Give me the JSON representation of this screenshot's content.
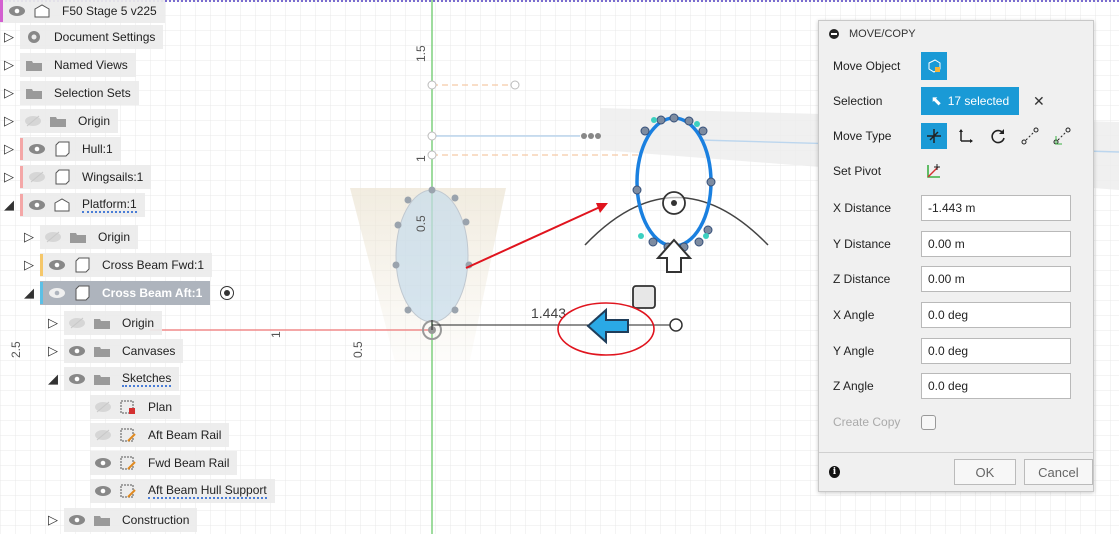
{
  "tree": {
    "root": "F50 Stage 5 v225",
    "document_settings": "Document Settings",
    "named_views": "Named Views",
    "selection_sets": "Selection Sets",
    "origin_top": "Origin",
    "hull": "Hull:1",
    "wingsails": "Wingsails:1",
    "platform": "Platform:1",
    "platform_origin": "Origin",
    "cross_beam_fwd": "Cross Beam Fwd:1",
    "cross_beam_aft": "Cross Beam Aft:1",
    "aft_origin": "Origin",
    "canvases": "Canvases",
    "sketches": "Sketches",
    "plan": "Plan",
    "aft_beam_rail": "Aft Beam Rail",
    "fwd_beam_rail": "Fwd Beam Rail",
    "aft_beam_hull_support": "Aft Beam Hull Support",
    "construction": "Construction"
  },
  "viewport": {
    "ruler_labels": [
      "1.5",
      "1",
      "0.5",
      "2.5",
      "1",
      "0.5"
    ],
    "dimension": "1.443"
  },
  "dialog": {
    "title": "MOVE/COPY",
    "move_object_label": "Move Object",
    "selection_label": "Selection",
    "selection_value": "17 selected",
    "clear_glyph": "✕",
    "move_type_label": "Move Type",
    "set_pivot_label": "Set Pivot",
    "x_distance_label": "X Distance",
    "x_distance": "-1.443 m",
    "y_distance_label": "Y Distance",
    "y_distance": "0.00 m",
    "z_distance_label": "Z Distance",
    "z_distance": "0.00 m",
    "x_angle_label": "X Angle",
    "x_angle": "0.0 deg",
    "y_angle_label": "Y Angle",
    "y_angle": "0.0 deg",
    "z_angle_label": "Z Angle",
    "z_angle": "0.0 deg",
    "create_copy_label": "Create Copy",
    "ok": "OK",
    "cancel": "Cancel"
  },
  "colors": {
    "accent": "#1a9ad6",
    "annotation_red": "#e0141e",
    "hull_bar": "#f4a7a7",
    "fwd_bar": "#f5c76a",
    "aft_bar": "#5cc0e6",
    "root_bar": "#d35fd0"
  }
}
